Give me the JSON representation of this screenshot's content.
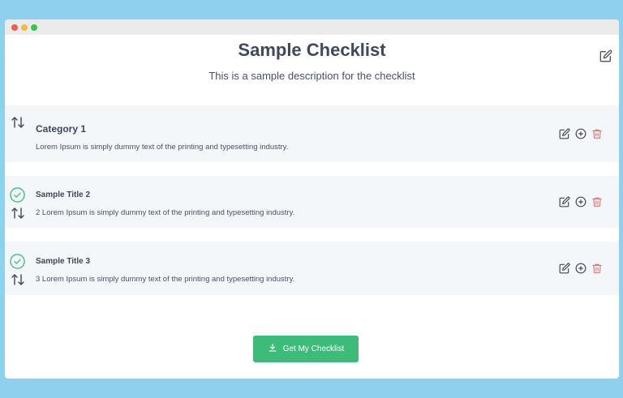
{
  "window": {
    "controls": [
      "close",
      "minimize",
      "maximize"
    ]
  },
  "header": {
    "title": "Sample Checklist",
    "description": "This is a sample description for the checklist",
    "edit_icon": "edit-icon"
  },
  "items": [
    {
      "title": "Category 1",
      "description": "Lorem Ipsum is simply dummy text of the printing and typesetting industry.",
      "checked": false,
      "icons": [
        "sort-icon",
        "edit-icon",
        "add-circle-icon",
        "trash-icon"
      ]
    },
    {
      "title": "Sample Title 2",
      "description": "2 Lorem Ipsum is simply dummy text of the printing and typesetting industry.",
      "checked": true,
      "icons": [
        "check-circle-icon",
        "sort-icon",
        "edit-icon",
        "add-circle-icon",
        "trash-icon"
      ]
    },
    {
      "title": "Sample Title 3",
      "description": "3 Lorem Ipsum is simply dummy text of the printing and typesetting industry.",
      "checked": true,
      "icons": [
        "check-circle-icon",
        "sort-icon",
        "edit-icon",
        "add-circle-icon",
        "trash-icon"
      ]
    }
  ],
  "cta": {
    "label": "Get My Checklist",
    "icon": "download-icon"
  },
  "colors": {
    "background": "#8fd0ef",
    "accent": "#3dbb79",
    "row_background": "#f4f7fa",
    "delete": "#e07b7b"
  }
}
